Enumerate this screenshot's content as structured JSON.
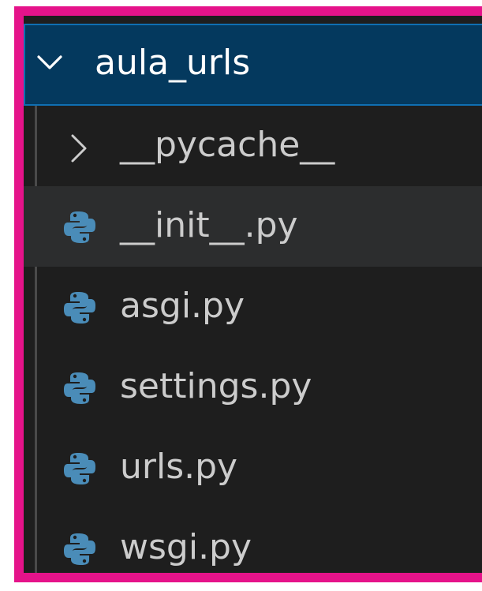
{
  "explorer": {
    "folder": {
      "name": "aula_urls",
      "expanded": true,
      "icon": "chevron-down-icon"
    },
    "items": [
      {
        "label": "__pycache__",
        "kind": "folder",
        "icon": "chevron-right-icon"
      },
      {
        "label": "__init__.py",
        "kind": "file",
        "icon": "python-icon",
        "hovered": true
      },
      {
        "label": "asgi.py",
        "kind": "file",
        "icon": "python-icon"
      },
      {
        "label": "settings.py",
        "kind": "file",
        "icon": "python-icon"
      },
      {
        "label": "urls.py",
        "kind": "file",
        "icon": "python-icon"
      },
      {
        "label": "wsgi.py",
        "kind": "file",
        "icon": "python-icon"
      }
    ]
  },
  "colors": {
    "highlight_border": "#e5138a",
    "folder_selected_bg": "#04395e",
    "folder_selected_border": "#0f6fb2",
    "sidebar_bg": "#1e1e1e",
    "hover_row_bg": "#2c2d2e",
    "text": "#cccccc",
    "python_icon": "#4a8cb8"
  }
}
